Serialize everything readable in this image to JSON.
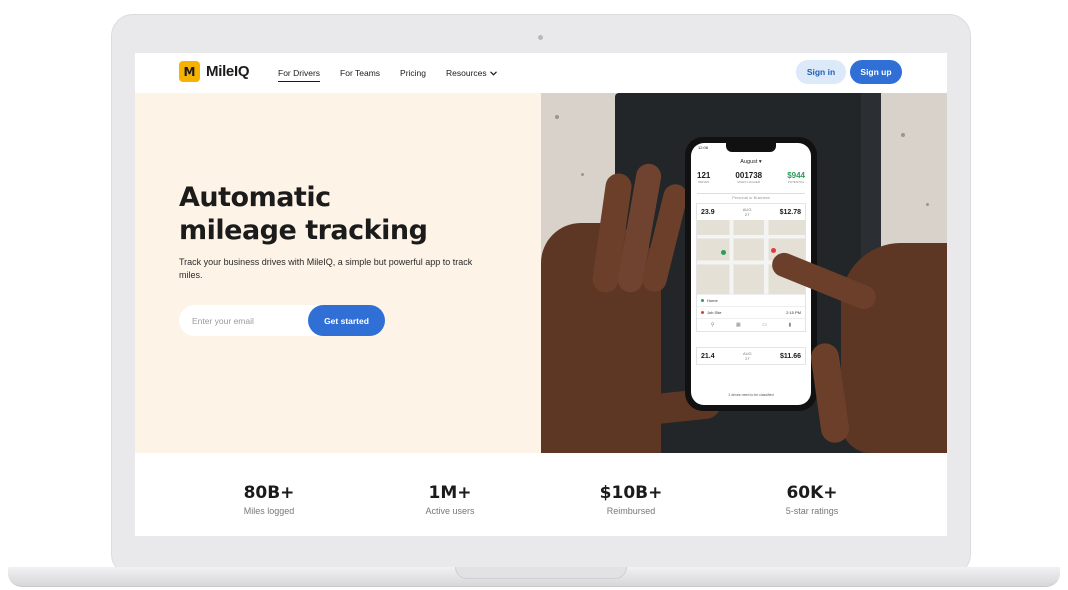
{
  "brand": {
    "logo_mark": "M",
    "name": "MileIQ",
    "accent": "#f6b200",
    "primary": "#2f6fd6"
  },
  "nav": {
    "links": [
      {
        "label": "For Drivers"
      },
      {
        "label": "For Teams"
      },
      {
        "label": "Pricing"
      },
      {
        "label": "Resources"
      }
    ],
    "active": "For Drivers",
    "sign_in": "Sign in",
    "sign_up": "Sign up"
  },
  "hero": {
    "title_line1": "Automatic",
    "title_line2": "mileage tracking",
    "subtitle": "Track your business drives with MileIQ, a simple but powerful app to track miles.",
    "email_placeholder": "Enter your email",
    "cta": "Get started",
    "background": "#fdf3e6"
  },
  "phone": {
    "status_time": "12:08",
    "month": "August ▾",
    "stats": [
      {
        "value": "121",
        "label": "DRIVES"
      },
      {
        "value": "001738",
        "label": "MILES LOGGED"
      },
      {
        "value": "$944",
        "label": "POTENTIAL"
      }
    ],
    "toggle_label": "Personal or Business",
    "drive1": {
      "miles": "23.9",
      "month_tag": "AUG",
      "day": "27",
      "amount": "$12.78"
    },
    "locations": [
      {
        "name": "Home",
        "color": "#2a9d5a"
      },
      {
        "name": "Job Site",
        "color": "#e03a3a",
        "time": "2:15 PM"
      }
    ],
    "drive2": {
      "miles": "21.4",
      "month_tag": "AUG",
      "day": "27",
      "amount": "$11.66"
    },
    "footer": "2 drives need to be classified"
  },
  "stats": [
    {
      "value": "80B+",
      "label": "Miles logged"
    },
    {
      "value": "1M+",
      "label": "Active users"
    },
    {
      "value": "$10B+",
      "label": "Reimbursed"
    },
    {
      "value": "60K+",
      "label": "5-star ratings"
    }
  ]
}
